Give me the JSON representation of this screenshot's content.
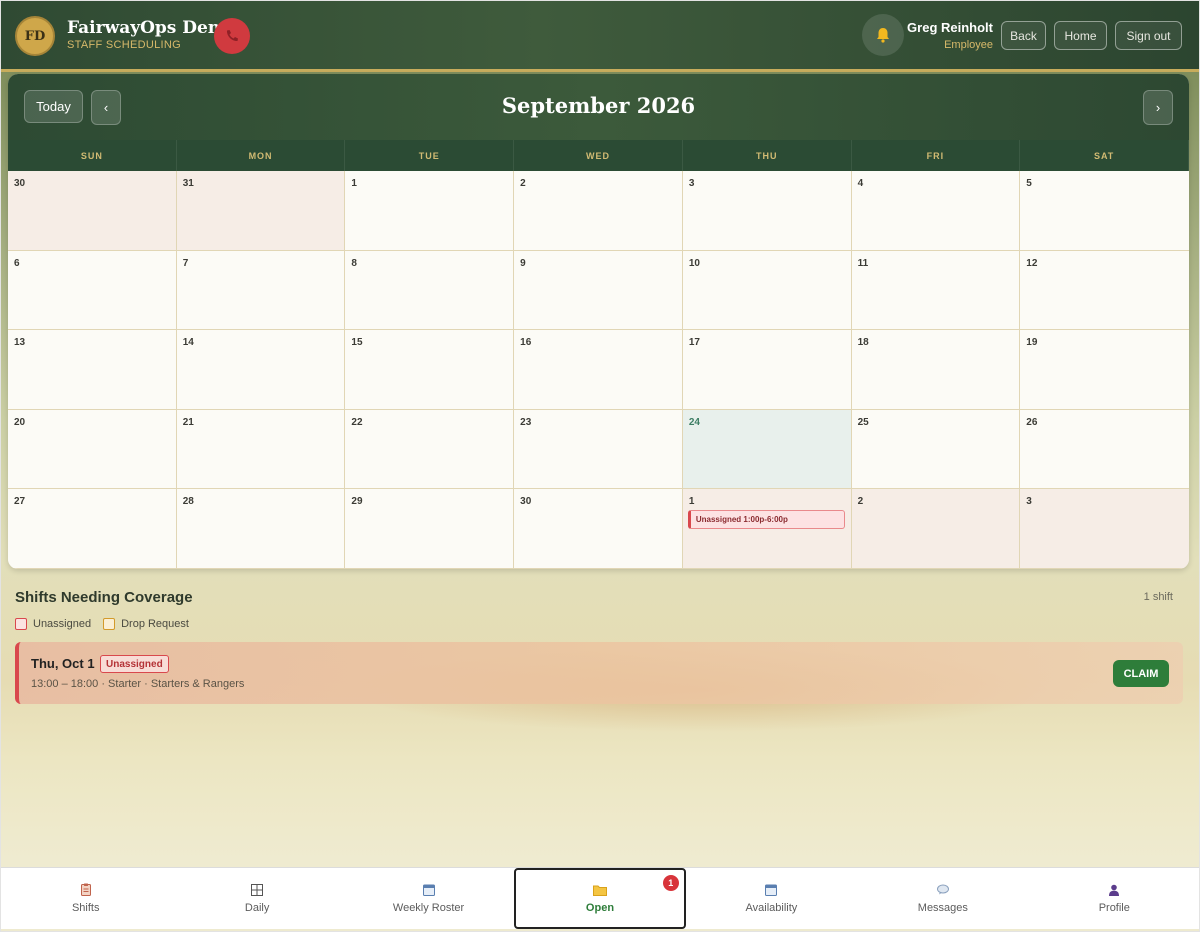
{
  "header": {
    "logo_initials": "FD",
    "title": "FairwayOps Demo",
    "subtitle": "STAFF SCHEDULING",
    "user_name": "Greg Reinholt",
    "user_role": "Employee",
    "back_label": "Back",
    "home_label": "Home",
    "signout_label": "Sign out"
  },
  "calendar": {
    "today_label": "Today",
    "prev_label": "‹",
    "next_label": "›",
    "month_title": "September 2026",
    "weekdays": [
      "SUN",
      "MON",
      "TUE",
      "WED",
      "THU",
      "FRI",
      "SAT"
    ],
    "weeks": [
      [
        {
          "day": "30",
          "other": true
        },
        {
          "day": "31",
          "other": true
        },
        {
          "day": "1"
        },
        {
          "day": "2"
        },
        {
          "day": "3"
        },
        {
          "day": "4"
        },
        {
          "day": "5"
        }
      ],
      [
        {
          "day": "6"
        },
        {
          "day": "7"
        },
        {
          "day": "8"
        },
        {
          "day": "9"
        },
        {
          "day": "10"
        },
        {
          "day": "11"
        },
        {
          "day": "12"
        }
      ],
      [
        {
          "day": "13"
        },
        {
          "day": "14"
        },
        {
          "day": "15"
        },
        {
          "day": "16"
        },
        {
          "day": "17"
        },
        {
          "day": "18"
        },
        {
          "day": "19"
        }
      ],
      [
        {
          "day": "20"
        },
        {
          "day": "21"
        },
        {
          "day": "22"
        },
        {
          "day": "23"
        },
        {
          "day": "24",
          "today": true
        },
        {
          "day": "25"
        },
        {
          "day": "26"
        }
      ],
      [
        {
          "day": "27"
        },
        {
          "day": "28"
        },
        {
          "day": "29"
        },
        {
          "day": "30"
        },
        {
          "day": "1",
          "other": true,
          "event": "Unassigned 1:00p-6:00p"
        },
        {
          "day": "2",
          "other": true
        },
        {
          "day": "3",
          "other": true
        }
      ]
    ]
  },
  "coverage": {
    "title": "Shifts Needing Coverage",
    "count": "1 shift",
    "legend": [
      {
        "label": "Unassigned",
        "color": "#d9484d"
      },
      {
        "label": "Drop Request",
        "color": "#d39a2a"
      }
    ],
    "shift": {
      "date": "Thu, Oct 1",
      "status": "Unassigned",
      "detail": "13:00 – 18:00 · Starter · Starters & Rangers",
      "claim_label": "CLAIM"
    }
  },
  "bottom_nav": {
    "items": [
      {
        "label": "Shifts",
        "icon": "clipboard-icon"
      },
      {
        "label": "Daily",
        "icon": "grid-icon"
      },
      {
        "label": "Weekly Roster",
        "icon": "calendar-icon"
      },
      {
        "label": "Open",
        "icon": "folder-icon",
        "badge": "1",
        "active": true
      },
      {
        "label": "Availability",
        "icon": "calendar-icon"
      },
      {
        "label": "Messages",
        "icon": "chat-bubble-icon"
      },
      {
        "label": "Profile",
        "icon": "person-icon"
      }
    ]
  },
  "colors": {
    "accent_green": "#2e7d3a",
    "header_green": "#2d4a33",
    "gold": "#c7ac5c",
    "alert_red": "#d9484d"
  }
}
